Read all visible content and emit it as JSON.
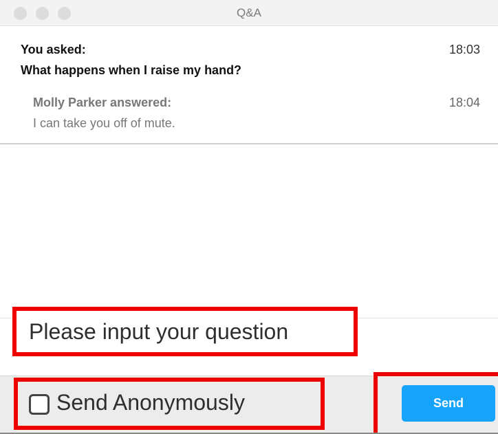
{
  "window": {
    "title": "Q&A"
  },
  "qa": {
    "question": {
      "label": "You asked:",
      "time": "18:03",
      "text": "What happens when I raise my hand?"
    },
    "answer": {
      "label": "Molly Parker answered:",
      "time": "18:04",
      "text": "I can take you off of mute."
    }
  },
  "compose": {
    "placeholder": "Please input your question",
    "anonymous_label": "Send Anonymously",
    "anonymous_checked": false,
    "send_label": "Send"
  },
  "colors": {
    "highlight": "#ee0000",
    "send_button": "#15a4f9"
  }
}
